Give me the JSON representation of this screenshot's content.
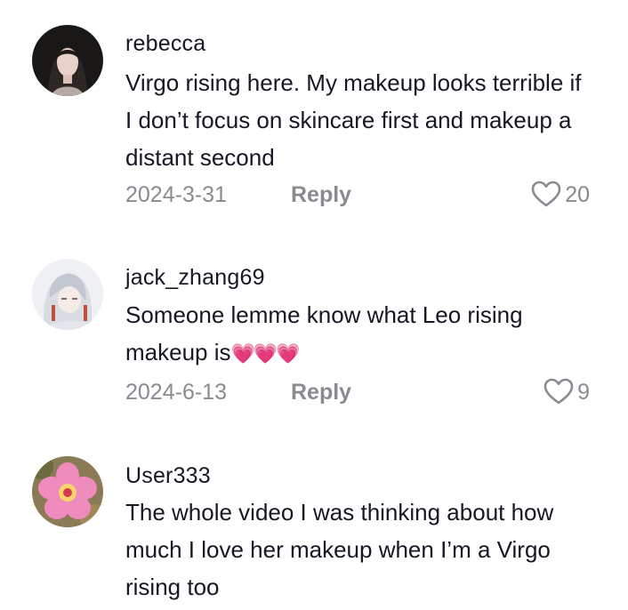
{
  "comments": [
    {
      "username": "rebecca",
      "text": "Virgo rising here. My makeup looks terrible if I don’t focus on skincare first and makeup a distant second",
      "date": "2024-3-31",
      "reply_label": "Reply",
      "likes": "20",
      "avatar_icon": "profile-photo-woman"
    },
    {
      "username": "jack_zhang69",
      "text": "Someone lemme know what Leo rising makeup is",
      "emoji": "💗💗💗",
      "date": "2024-6-13",
      "reply_label": "Reply",
      "likes": "9",
      "avatar_icon": "anime-character-avatar"
    },
    {
      "username": "User333",
      "text": "The whole video I was thinking about how much I love her makeup when I’m a Virgo rising too",
      "avatar_icon": "hibiscus-flower-avatar"
    }
  ],
  "colors": {
    "text": "#161823",
    "muted": "#8a8b91",
    "heart_emoji": "#e6499b"
  }
}
